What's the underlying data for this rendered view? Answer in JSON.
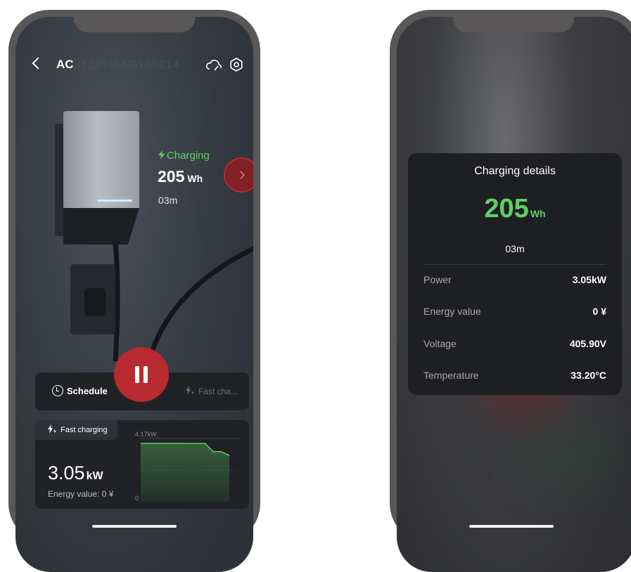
{
  "left_screen": {
    "header": {
      "title": "AC",
      "serial": "31ZEH4AG130214"
    },
    "status": {
      "label": "Charging",
      "energy_value": "205",
      "energy_unit": "Wh",
      "duration": "03m"
    },
    "controls": {
      "schedule_label": "Schedule",
      "fast_charge_label": "Fast cha..."
    },
    "power_card": {
      "mode_label": "Fast charging",
      "power_value": "3.05",
      "power_unit": "kW",
      "energy_value_text": "Energy value: 0 ¥",
      "chart_data": {
        "type": "area",
        "y_top_label": "4.17kW",
        "y_bottom_label": "0",
        "ylim": [
          0,
          4.17
        ],
        "values": [
          3.85,
          3.85,
          3.85,
          3.85,
          3.85,
          3.85,
          3.84,
          3.84,
          3.84,
          3.3,
          3.3,
          3.05
        ],
        "color": "#5fd163"
      }
    }
  },
  "right_screen": {
    "details": {
      "title": "Charging details",
      "energy_value": "205",
      "energy_unit": "Wh",
      "duration": "03m",
      "rows": [
        {
          "label": "Power",
          "value": "3.05kW"
        },
        {
          "label": "Energy value",
          "value": "0 ¥"
        },
        {
          "label": "Voltage",
          "value": "405.90V"
        },
        {
          "label": "Temperature",
          "value": "33.20°C"
        }
      ]
    }
  },
  "colors": {
    "accent_green": "#5fd163",
    "pause_red": "#b72a2f"
  }
}
